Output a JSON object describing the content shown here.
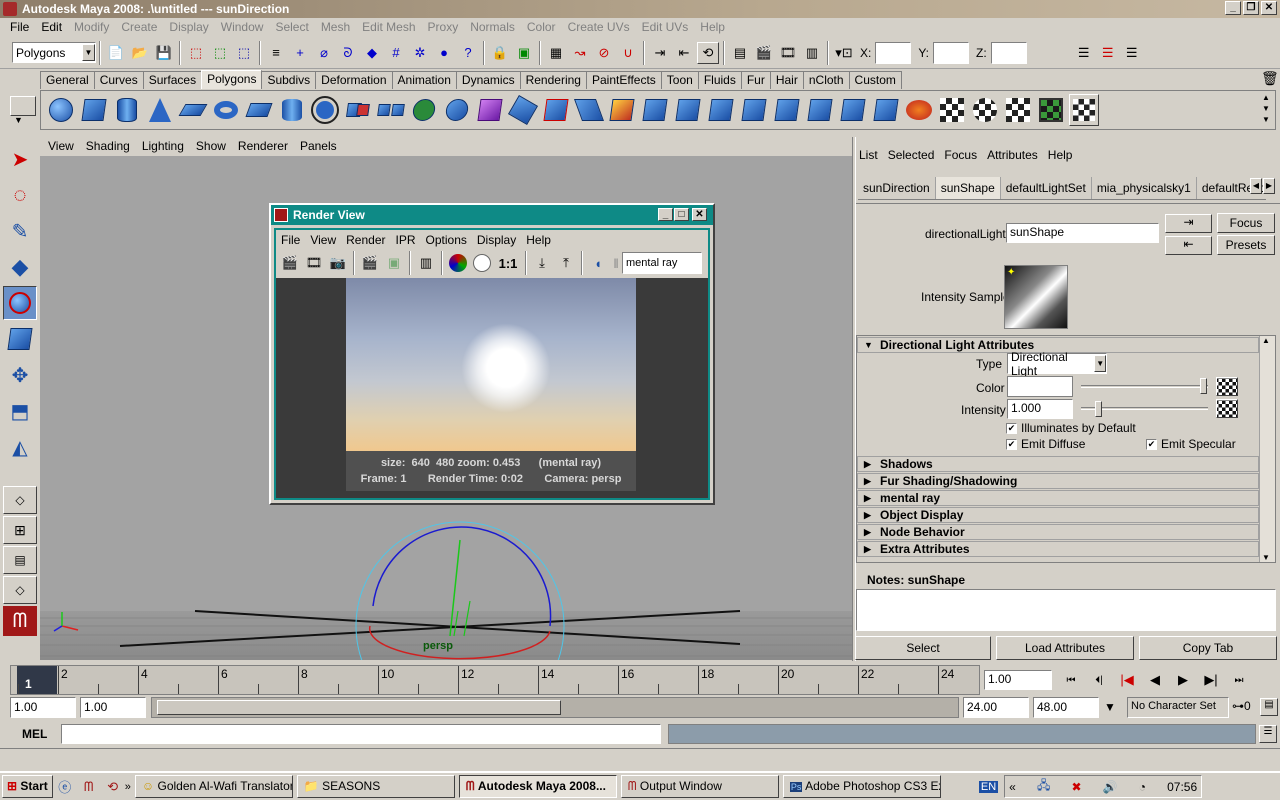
{
  "window": {
    "title": "Autodesk Maya 2008: .\\untitled   ---   sunDirection"
  },
  "menubar": [
    "File",
    "Edit",
    "Modify",
    "Create",
    "Display",
    "Window",
    "Select",
    "Mesh",
    "Edit Mesh",
    "Proxy",
    "Normals",
    "Color",
    "Create UVs",
    "Edit UVs",
    "Help"
  ],
  "statusline": {
    "mode": "Polygons",
    "x_label": "X:",
    "y_label": "Y:",
    "z_label": "Z:"
  },
  "shelf_tabs": [
    "General",
    "Curves",
    "Surfaces",
    "Polygons",
    "Subdivs",
    "Deformation",
    "Animation",
    "Dynamics",
    "Rendering",
    "PaintEffects",
    "Toon",
    "Fluids",
    "Fur",
    "Hair",
    "nCloth",
    "Custom"
  ],
  "viewport": {
    "menu": [
      "View",
      "Shading",
      "Lighting",
      "Show",
      "Renderer",
      "Panels"
    ],
    "camera_label": "persp"
  },
  "render_view": {
    "title": "Render View",
    "menu": [
      "File",
      "View",
      "Render",
      "IPR",
      "Options",
      "Display",
      "Help"
    ],
    "ratio_label": "1:1",
    "renderer": "mental ray",
    "info_line1": "size:  640  480 zoom: 0.453      (mental ray)",
    "info_line2": "Frame: 1       Render Time: 0:02       Camera: persp"
  },
  "attribute_editor": {
    "menu": [
      "List",
      "Selected",
      "Focus",
      "Attributes",
      "Help"
    ],
    "tabs": [
      "sunDirection",
      "sunShape",
      "defaultLightSet",
      "mia_physicalsky1",
      "defaultRenderL"
    ],
    "node_type_label": "directionalLight:",
    "node_name": "sunShape",
    "focus_label": "Focus",
    "presets_label": "Presets",
    "intensity_sample_label": "Intensity Sample",
    "section_directional": "Directional Light Attributes",
    "type_label": "Type",
    "type_value": "Directional Light",
    "color_label": "Color",
    "intensity_label": "Intensity",
    "intensity_value": "1.000",
    "intensity_slider": 0.12,
    "illuminates_label": "Illuminates by Default",
    "emit_diffuse_label": "Emit Diffuse",
    "emit_specular_label": "Emit Specular",
    "sections": [
      "Shadows",
      "Fur Shading/Shadowing",
      "mental ray",
      "Object Display",
      "Node Behavior",
      "Extra Attributes"
    ],
    "notes_label": "Notes:  sunShape",
    "buttons": [
      "Select",
      "Load Attributes",
      "Copy Tab"
    ]
  },
  "timeline": {
    "ticks": [
      "2",
      "4",
      "6",
      "8",
      "10",
      "12",
      "14",
      "16",
      "18",
      "20",
      "22",
      "24"
    ],
    "current_frame": "1",
    "current_time": "1.00"
  },
  "range": {
    "start": "1.00",
    "playback_start": "1.00",
    "playback_end": "24.00",
    "end": "48.00",
    "character_set": "No Character Set"
  },
  "mel": {
    "label": "MEL"
  },
  "taskbar": {
    "start_label": "Start",
    "items": [
      "Golden Al-Wafi Translator",
      "SEASONS",
      "Autodesk Maya 2008...",
      "Output Window",
      "Adobe Photoshop CS3 Ex..."
    ],
    "lang": "EN",
    "clock": "07:56"
  },
  "colors": {
    "title_gradient": "#8e7e6a",
    "render_view_title": "#0e8a86",
    "viewport_bg": "#a3a3a3",
    "shelf_icon_blue": "#1b4fa5"
  }
}
